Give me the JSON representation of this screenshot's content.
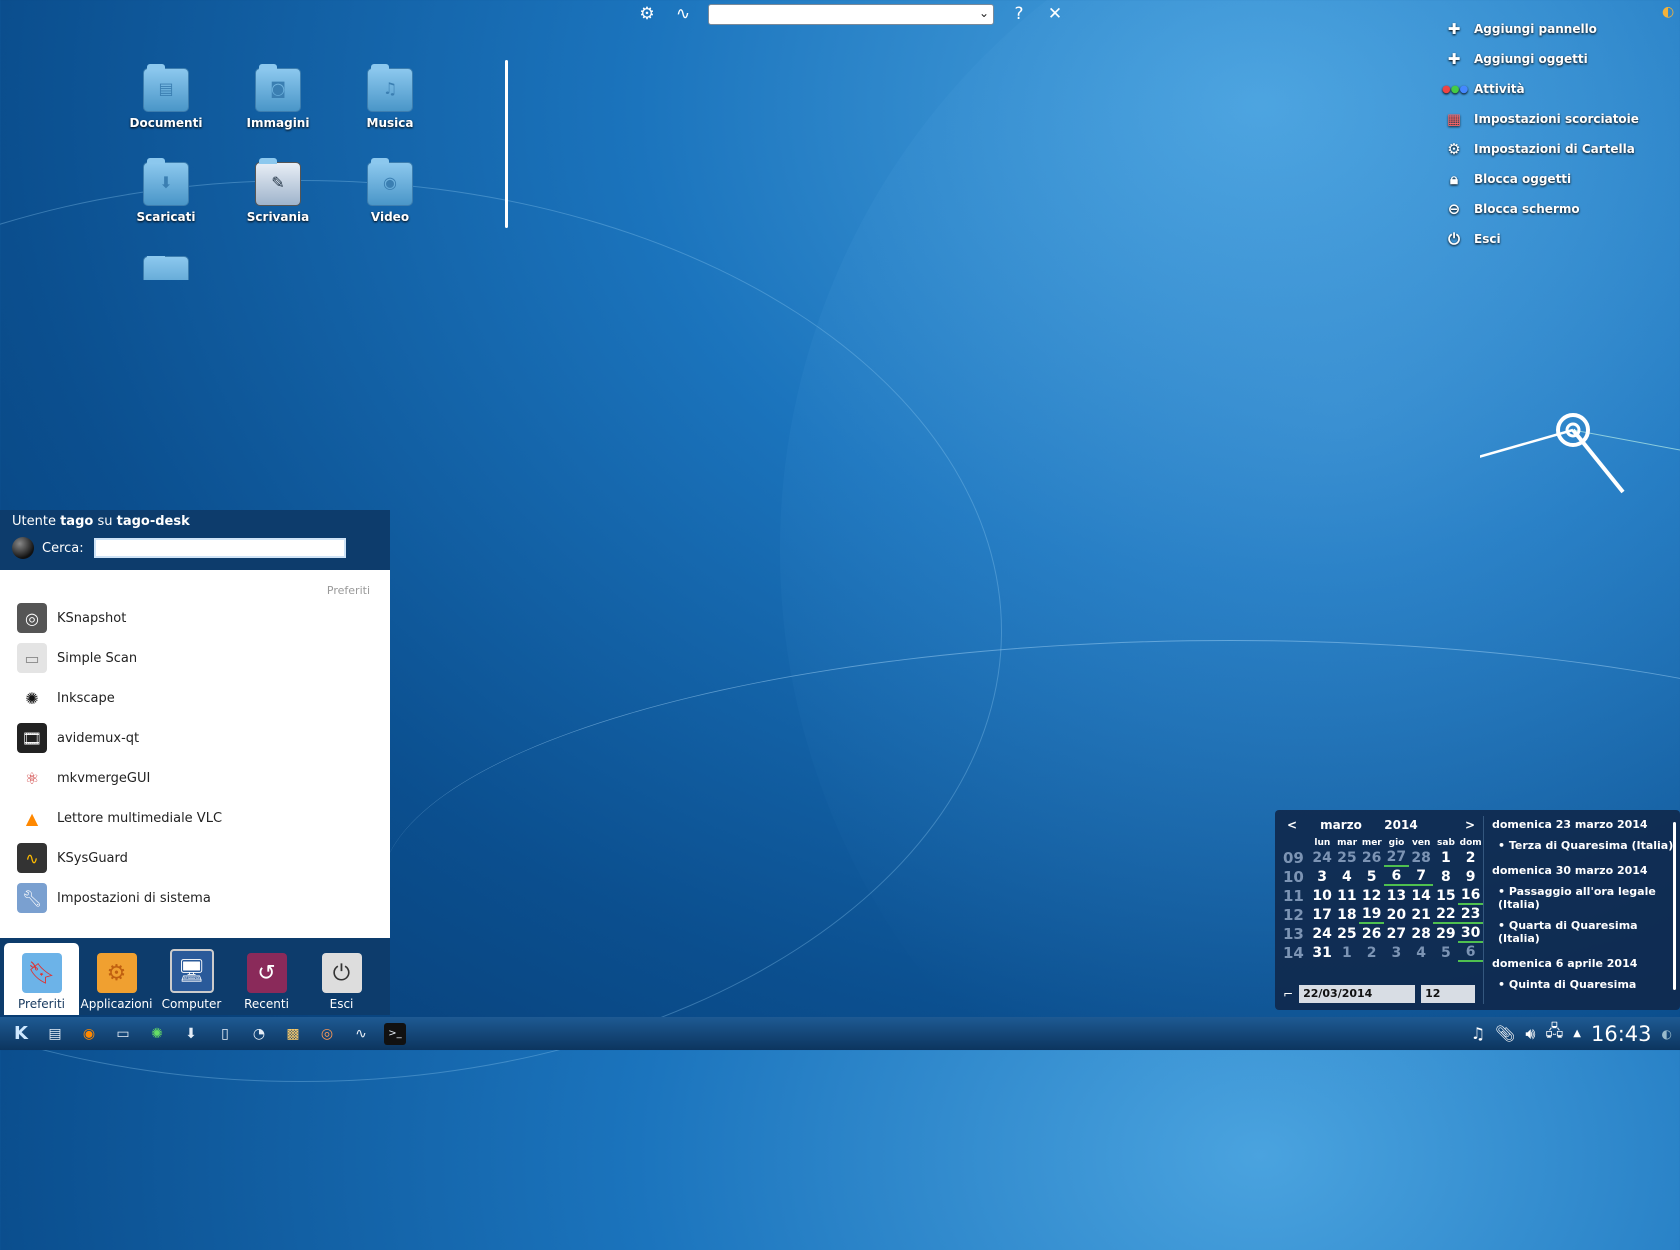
{
  "toolbox": {
    "activity_value": "",
    "help_label": "?",
    "menu": [
      {
        "label": "Aggiungi pannello",
        "icon": "plus-icon"
      },
      {
        "label": "Aggiungi oggetti",
        "icon": "plus-icon"
      },
      {
        "label": "Attività",
        "icon": "activities-icon"
      },
      {
        "label": "Impostazioni scorciatoie",
        "icon": "shortcuts-icon"
      },
      {
        "label": "Impostazioni di Cartella",
        "icon": "gear-icon"
      },
      {
        "label": "Blocca oggetti",
        "icon": "lock-icon"
      },
      {
        "label": "Blocca schermo",
        "icon": "lock-screen-icon"
      },
      {
        "label": "Esci",
        "icon": "power-icon"
      }
    ]
  },
  "desktop": {
    "folders": [
      {
        "label": "Documenti",
        "icon": "document-folder-icon"
      },
      {
        "label": "Immagini",
        "icon": "pictures-folder-icon"
      },
      {
        "label": "Musica",
        "icon": "music-folder-icon"
      },
      {
        "label": "Scaricati",
        "icon": "download-folder-icon"
      },
      {
        "label": "Scrivania",
        "icon": "desktop-folder-icon"
      },
      {
        "label": "Video",
        "icon": "video-folder-icon"
      }
    ]
  },
  "kickoff": {
    "user_prefix": "Utente",
    "user_name": "tago",
    "user_on": "su",
    "host": "tago-desk",
    "search_label": "Cerca:",
    "section": "Preferiti",
    "apps": [
      {
        "label": "KSnapshot",
        "icon": "ksnapshot-icon"
      },
      {
        "label": "Simple Scan",
        "icon": "scanner-icon"
      },
      {
        "label": "Inkscape",
        "icon": "inkscape-icon"
      },
      {
        "label": "avidemux-qt",
        "icon": "avidemux-icon"
      },
      {
        "label": "mkvmergeGUI",
        "icon": "mkvmerge-icon"
      },
      {
        "label": "Lettore multimediale VLC",
        "icon": "vlc-icon"
      },
      {
        "label": "KSysGuard",
        "icon": "ksysguard-icon"
      },
      {
        "label": "Impostazioni di sistema",
        "icon": "system-settings-icon"
      }
    ],
    "tabs": [
      {
        "label": "Preferiti",
        "icon": "bookmark-icon"
      },
      {
        "label": "Applicazioni",
        "icon": "applications-icon"
      },
      {
        "label": "Computer",
        "icon": "computer-icon"
      },
      {
        "label": "Recenti",
        "icon": "recent-icon"
      },
      {
        "label": "Esci",
        "icon": "power-icon"
      }
    ]
  },
  "calendar": {
    "prev": "<",
    "next": ">",
    "month": "marzo",
    "year": "2014",
    "dows": [
      "lun",
      "mar",
      "mer",
      "gio",
      "ven",
      "sab",
      "dom"
    ],
    "weeks": [
      {
        "wk": "09",
        "days": [
          "24",
          "25",
          "26",
          "27",
          "28",
          "1",
          "2"
        ]
      },
      {
        "wk": "10",
        "days": [
          "3",
          "4",
          "5",
          "6",
          "7",
          "8",
          "9"
        ]
      },
      {
        "wk": "11",
        "days": [
          "10",
          "11",
          "12",
          "13",
          "14",
          "15",
          "16"
        ]
      },
      {
        "wk": "12",
        "days": [
          "17",
          "18",
          "19",
          "20",
          "21",
          "22",
          "23"
        ]
      },
      {
        "wk": "13",
        "days": [
          "24",
          "25",
          "26",
          "27",
          "28",
          "29",
          "30"
        ]
      },
      {
        "wk": "14",
        "days": [
          "31",
          "1",
          "2",
          "3",
          "4",
          "5",
          "6"
        ]
      }
    ],
    "events": [
      {
        "date": "domenica 23 marzo 2014",
        "items": [
          "Terza di Quaresima (Italia)"
        ]
      },
      {
        "date": "domenica 30 marzo 2014",
        "items": [
          "Passaggio all'ora legale (Italia)",
          "Quarta di Quaresima (Italia)"
        ]
      },
      {
        "date": "domenica 6 aprile 2014",
        "items": [
          "Quinta di Quaresima"
        ]
      }
    ],
    "date_value": "22/03/2014",
    "week_value": "12"
  },
  "panel": {
    "clock": "16:43",
    "tasks": [
      "kde-icon",
      "file-manager-icon",
      "vlc-icon",
      "scanner-icon",
      "inkscape-icon",
      "download-icon",
      "document-icon",
      "eye-icon",
      "image-icon",
      "ksnapshot-icon",
      "ksysguard-icon",
      "terminal-icon"
    ]
  }
}
